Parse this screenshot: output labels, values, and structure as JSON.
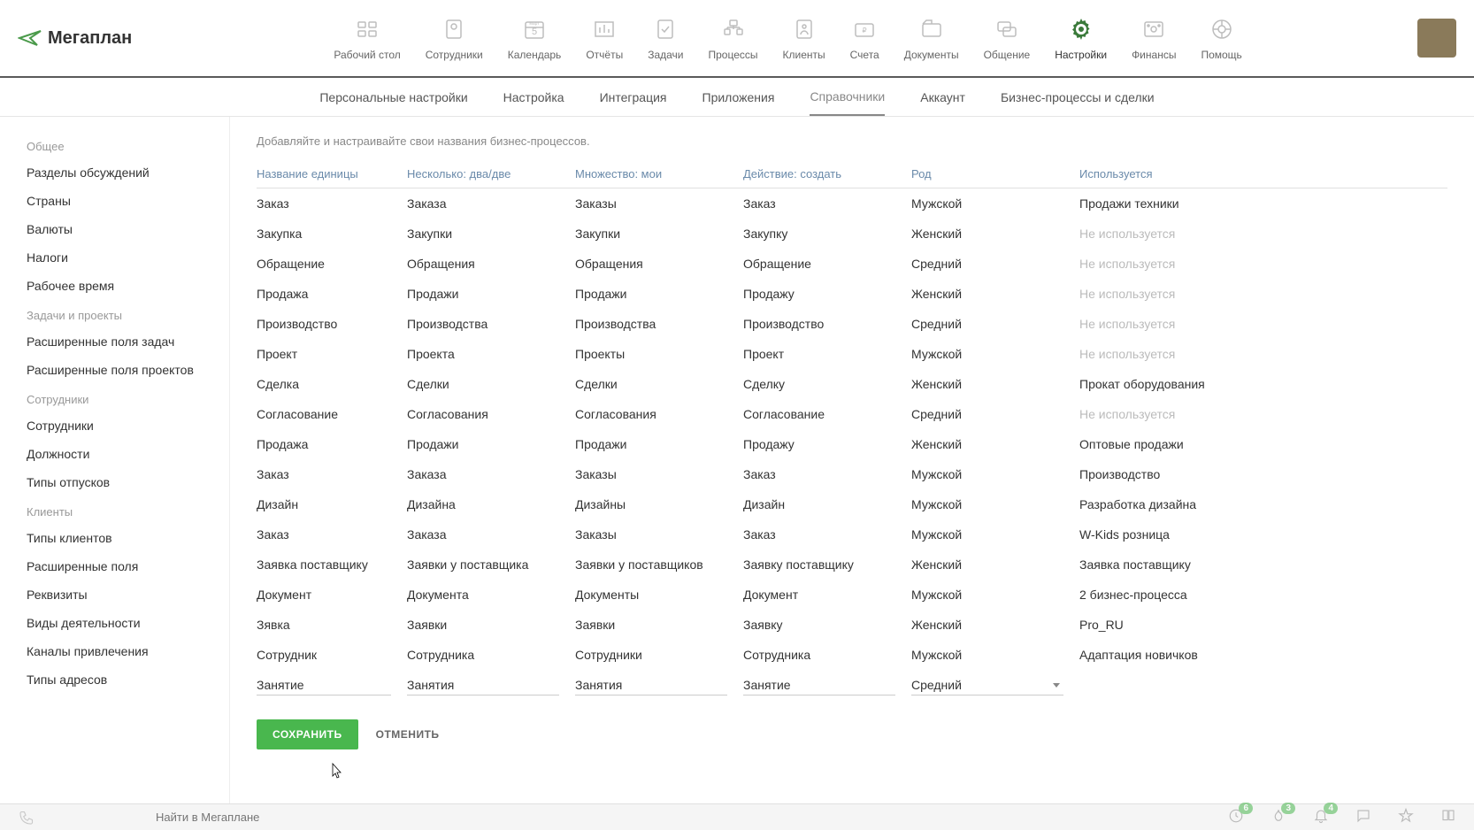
{
  "logo": "Мегаплан",
  "topnav": [
    {
      "label": "Рабочий стол"
    },
    {
      "label": "Сотрудники"
    },
    {
      "label": "Календарь",
      "badge": "март",
      "day": "5"
    },
    {
      "label": "Отчёты"
    },
    {
      "label": "Задачи"
    },
    {
      "label": "Процессы"
    },
    {
      "label": "Клиенты"
    },
    {
      "label": "Счета"
    },
    {
      "label": "Документы"
    },
    {
      "label": "Общение"
    },
    {
      "label": "Настройки"
    },
    {
      "label": "Финансы"
    },
    {
      "label": "Помощь"
    }
  ],
  "subtabs": [
    "Персональные настройки",
    "Настройка",
    "Интеграция",
    "Приложения",
    "Справочники",
    "Аккаунт",
    "Бизнес-процессы и сделки"
  ],
  "subtab_active": "Справочники",
  "sidebar": [
    {
      "title": "Общее",
      "items": [
        "Разделы обсуждений",
        "Страны",
        "Валюты",
        "Налоги",
        "Рабочее время"
      ]
    },
    {
      "title": "Задачи и проекты",
      "items": [
        "Расширенные поля задач",
        "Расширенные поля проектов"
      ]
    },
    {
      "title": "Сотрудники",
      "items": [
        "Сотрудники",
        "Должности",
        "Типы отпусков"
      ]
    },
    {
      "title": "Клиенты",
      "items": [
        "Типы клиентов",
        "Расширенные поля",
        "Реквизиты",
        "Виды деятельности",
        "Каналы привлечения",
        "Типы адресов"
      ]
    }
  ],
  "page_desc": "Добавляйте и настраивайте свои названия бизнес-процессов.",
  "columns": [
    "Название единицы",
    "Несколько: два/две",
    "Множество: мои",
    "Действие: создать",
    "Род",
    "Используется"
  ],
  "rows": [
    {
      "c": [
        "Заказ",
        "Заказа",
        "Заказы",
        "Заказ",
        "Мужской",
        "Продажи техники"
      ],
      "used": true
    },
    {
      "c": [
        "Закупка",
        "Закупки",
        "Закупки",
        "Закупку",
        "Женский",
        "Не используется"
      ],
      "used": false
    },
    {
      "c": [
        "Обращение",
        "Обращения",
        "Обращения",
        "Обращение",
        "Средний",
        "Не используется"
      ],
      "used": false
    },
    {
      "c": [
        "Продажа",
        "Продажи",
        "Продажи",
        "Продажу",
        "Женский",
        "Не используется"
      ],
      "used": false
    },
    {
      "c": [
        "Производство",
        "Производства",
        "Производства",
        "Производство",
        "Средний",
        "Не используется"
      ],
      "used": false
    },
    {
      "c": [
        "Проект",
        "Проекта",
        "Проекты",
        "Проект",
        "Мужской",
        "Не используется"
      ],
      "used": false
    },
    {
      "c": [
        "Сделка",
        "Сделки",
        "Сделки",
        "Сделку",
        "Женский",
        "Прокат оборудования"
      ],
      "used": true
    },
    {
      "c": [
        "Согласование",
        "Согласования",
        "Согласования",
        "Согласование",
        "Средний",
        "Не используется"
      ],
      "used": false
    },
    {
      "c": [
        "Продажа",
        "Продажи",
        "Продажи",
        "Продажу",
        "Женский",
        "Оптовые продажи"
      ],
      "used": true
    },
    {
      "c": [
        "Заказ",
        "Заказа",
        "Заказы",
        "Заказ",
        "Мужской",
        "Производство"
      ],
      "used": true
    },
    {
      "c": [
        "Дизайн",
        "Дизайна",
        "Дизайны",
        "Дизайн",
        "Мужской",
        "Разработка дизайна"
      ],
      "used": true
    },
    {
      "c": [
        "Заказ",
        "Заказа",
        "Заказы",
        "Заказ",
        "Мужской",
        "W-Kids розница"
      ],
      "used": true
    },
    {
      "c": [
        "Заявка поставщику",
        "Заявки у поставщика",
        "Заявки у поставщиков",
        "Заявку поставщику",
        "Женский",
        "Заявка поставщику"
      ],
      "used": true
    },
    {
      "c": [
        "Документ",
        "Документа",
        "Документы",
        "Документ",
        "Мужской",
        "2 бизнес-процесса"
      ],
      "used": true
    },
    {
      "c": [
        "Зявка",
        "Заявки",
        "Заявки",
        "Заявку",
        "Женский",
        "Pro_RU"
      ],
      "used": true
    },
    {
      "c": [
        "Сотрудник",
        "Сотрудника",
        "Сотрудники",
        "Сотрудника",
        "Мужской",
        "Адаптация новичков"
      ],
      "used": true
    }
  ],
  "edit_row": {
    "c": [
      "Занятие",
      "Занятия",
      "Занятия",
      "Занятие",
      "Средний",
      ""
    ]
  },
  "save_label": "СОХРАНИТЬ",
  "cancel_label": "ОТМЕНИТЬ",
  "search_placeholder": "Найти в Мегаплане",
  "bottom_badges": {
    "clock": "6",
    "fire": "3",
    "bell": "4"
  }
}
